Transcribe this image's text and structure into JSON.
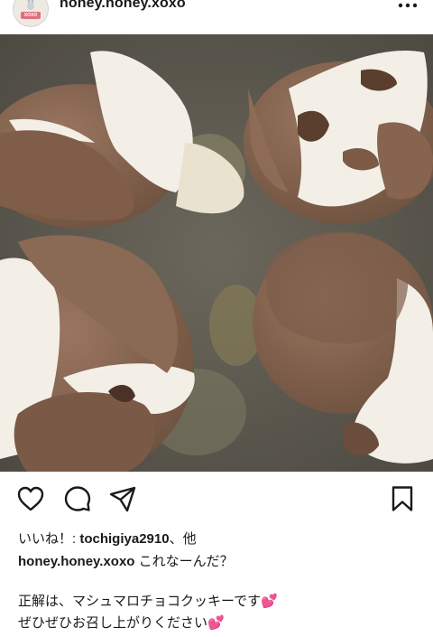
{
  "header": {
    "username": "honey.honey.xoxo",
    "avatar_badge": "XOXO",
    "more_icon": "more-horizontal-icon"
  },
  "actions": {
    "like_icon": "heart-icon",
    "comment_icon": "comment-icon",
    "share_icon": "send-icon",
    "save_icon": "bookmark-icon"
  },
  "likes": {
    "prefix": "いいね！: ",
    "user": "tochigiya2910",
    "suffix": "、他"
  },
  "caption": {
    "username": "honey.honey.xoxo",
    "text": " これなーんだ？"
  },
  "body": {
    "line1": "正解は、マシュマロチョコクッキーです",
    "line2": "ぜひぜひお召し上がりください",
    "emoji": "💕"
  },
  "colors": {
    "cookie": "#8a6650",
    "marshmallow": "#f3efe6",
    "tray": "#5a574e",
    "heart": "#e0457b"
  }
}
